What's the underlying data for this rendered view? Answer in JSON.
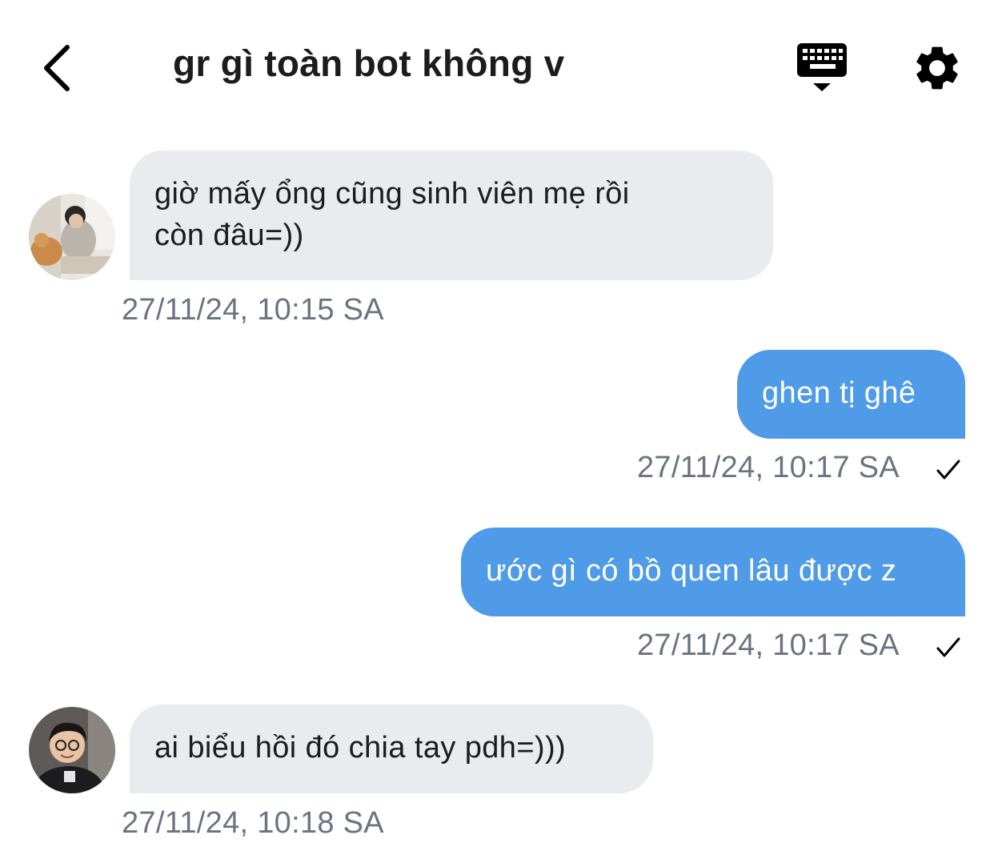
{
  "header": {
    "title": "gr gì toàn bot không v",
    "back_icon": "chevron-left-icon",
    "keyboard_icon": "keyboard-hide-icon",
    "settings_icon": "gear-icon"
  },
  "colors": {
    "incoming_bubble": "#e9ebef",
    "outgoing_bubble": "#4f9be8",
    "timestamp": "#6b7380"
  },
  "messages": [
    {
      "direction": "incoming",
      "line1": "giờ mấy ổng cũng sinh viên mẹ rồi",
      "line2": "còn đâu=))",
      "time": "27/11/24, 10:15 SA"
    },
    {
      "direction": "outgoing",
      "text": "ghen tị ghê",
      "time": "27/11/24, 10:17 SA",
      "status": "sent-check-icon"
    },
    {
      "direction": "outgoing",
      "text": "ước gì có bồ quen lâu được z",
      "time": "27/11/24, 10:17 SA",
      "status": "sent-check-icon"
    },
    {
      "direction": "incoming",
      "text": "ai biểu hồi đó chia tay pdh=)))",
      "time": "27/11/24, 10:18 SA"
    }
  ]
}
